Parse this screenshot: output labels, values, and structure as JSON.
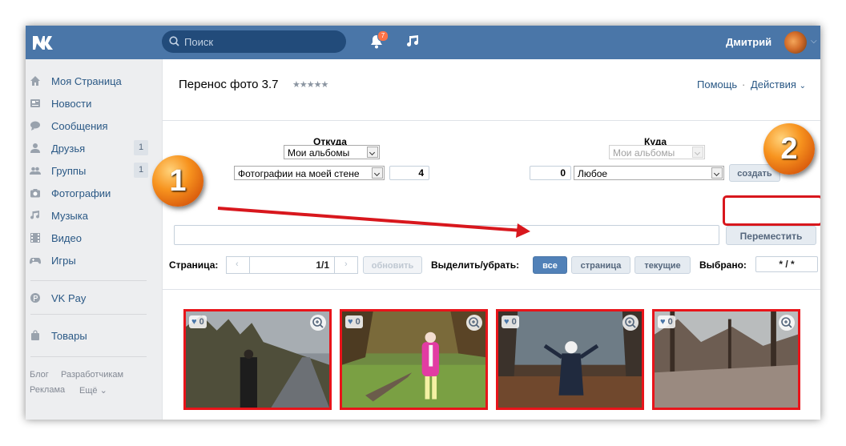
{
  "header": {
    "logo_icon": "vk-logo-icon",
    "search_placeholder": "Поиск",
    "notifications_count": "7",
    "user_name": "Дмитрий"
  },
  "sidebar": {
    "items": [
      {
        "label": "Моя Страница",
        "icon": "home-icon",
        "count": ""
      },
      {
        "label": "Новости",
        "icon": "news-icon",
        "count": ""
      },
      {
        "label": "Сообщения",
        "icon": "messages-icon",
        "count": ""
      },
      {
        "label": "Друзья",
        "icon": "friends-icon",
        "count": "1"
      },
      {
        "label": "Группы",
        "icon": "groups-icon",
        "count": "1"
      },
      {
        "label": "Фотографии",
        "icon": "camera-icon",
        "count": ""
      },
      {
        "label": "Музыка",
        "icon": "music-icon",
        "count": ""
      },
      {
        "label": "Видео",
        "icon": "video-icon",
        "count": ""
      },
      {
        "label": "Игры",
        "icon": "gamepad-icon",
        "count": ""
      },
      {
        "label": "VK Pay",
        "icon": "vkpay-icon",
        "count": ""
      },
      {
        "label": "Товары",
        "icon": "bag-icon",
        "count": ""
      }
    ],
    "footer": {
      "blog": "Блог",
      "developers": "Разработчикам",
      "ads": "Реклама",
      "more": "Ещё"
    }
  },
  "app": {
    "title": "Перенос фото 3.7",
    "stars": "★★★★★",
    "help": "Помощь",
    "separator": "·",
    "actions": "Действия"
  },
  "source": {
    "label": "Откуда",
    "album_type": "Мои альбомы",
    "album": "Фотографии на моей стене",
    "count": "4"
  },
  "destination": {
    "label": "Куда",
    "album_type": "Мои альбомы",
    "count": "0",
    "album": "Любое",
    "create_button": "создать"
  },
  "move_button": "Переместить",
  "pagination": {
    "label": "Страница:",
    "value": "1/1",
    "refresh_button": "обновить"
  },
  "selection": {
    "label": "Выделить/убрать:",
    "all_button": "все",
    "page_button": "страница",
    "current_button": "текущие",
    "selected_label": "Выбрано:",
    "selected_value": "* / *"
  },
  "photos": [
    {
      "likes": "0"
    },
    {
      "likes": "0"
    },
    {
      "likes": "0"
    },
    {
      "likes": "0"
    }
  ],
  "annotations": {
    "step1": "1",
    "step2": "2"
  },
  "colors": {
    "header": "#4a76a8",
    "link": "#2a5885",
    "highlight": "#e8141a",
    "accent_button": "#5181b8"
  }
}
